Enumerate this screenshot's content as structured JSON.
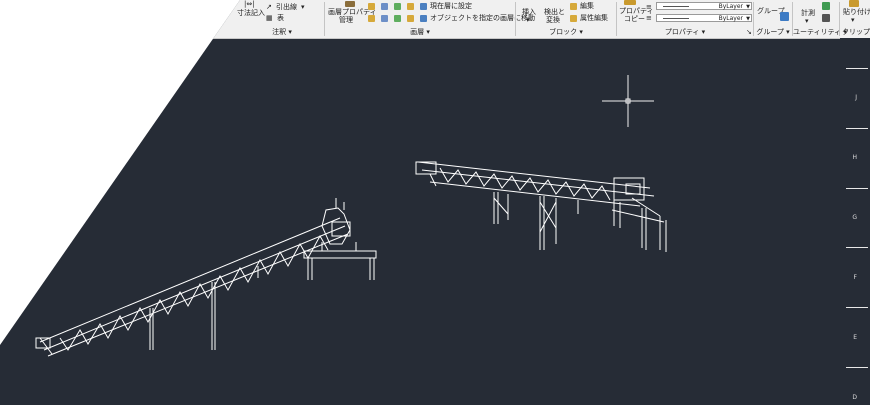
{
  "ribbon": {
    "annotate": {
      "dim_label": "寸法記入",
      "leader_label": "引出線",
      "table_label": "表",
      "group_label": "注釈"
    },
    "layers": {
      "props_label": "画層プロパティ",
      "props_label2": "管理",
      "set_current_label": "現在層に設定",
      "match_layer_label": "オブジェクトを指定の画層に移動",
      "group_label": "画層"
    },
    "block": {
      "insert_label": "挿入",
      "detect_label": "検出と",
      "detect_label2": "変換",
      "edit_label": "編集",
      "attr_edit_label": "属性編集",
      "group_label": "ブロック"
    },
    "properties": {
      "copy_label": "プロパティ",
      "copy_label2": "コピー",
      "linetype_value": "ByLayer",
      "lineweight_value": "ByLayer",
      "group_label": "プロパティ"
    },
    "groups": {
      "group_btn_label": "グループ",
      "group_label": "グループ"
    },
    "utilities": {
      "measure_label": "計測",
      "group_label": "ユーティリティ"
    },
    "clipboard": {
      "paste_label": "貼り付け",
      "group_label": "クリップボ"
    }
  },
  "ruler": {
    "labels": [
      "J",
      "H",
      "G",
      "F",
      "E",
      "D"
    ]
  },
  "colors": {
    "canvas": "#262c36",
    "ribbon": "#f0f0f0",
    "drawing": "#ffffff"
  }
}
